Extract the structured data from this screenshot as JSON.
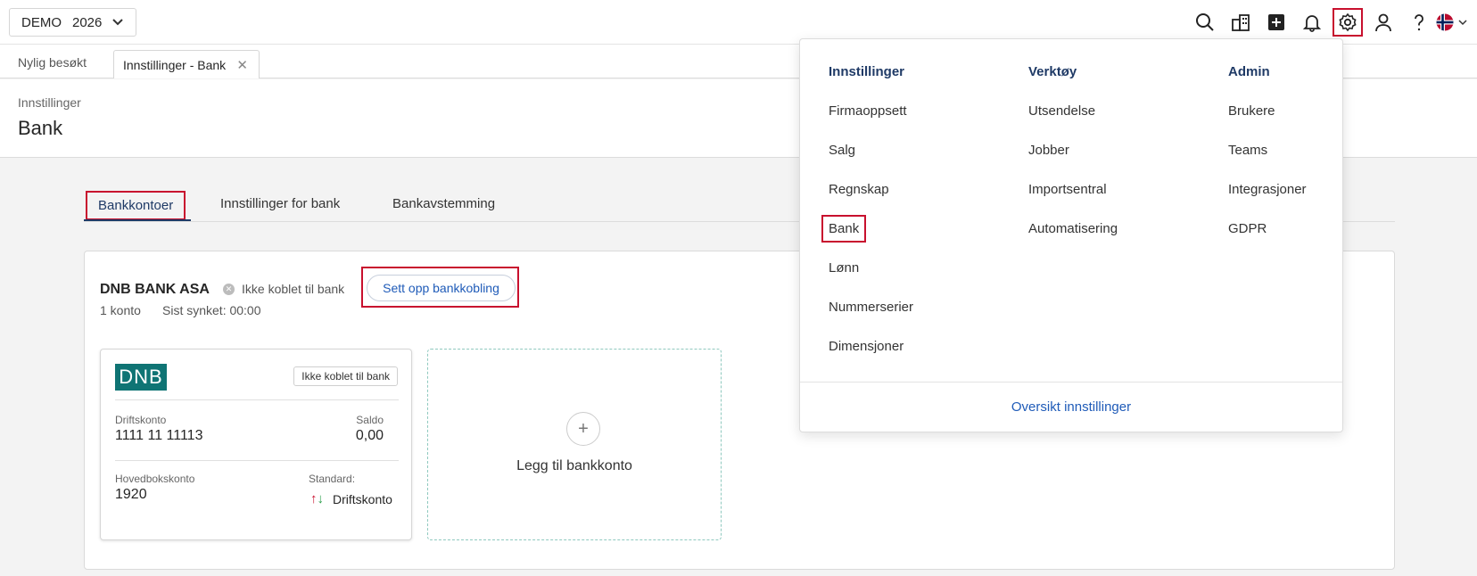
{
  "company": {
    "name": "DEMO",
    "year": "2026"
  },
  "topbar_icons": [
    "search-icon",
    "company-icon",
    "add-icon",
    "bell-icon",
    "settings-icon",
    "user-icon",
    "help-icon",
    "flag-icon"
  ],
  "tabs": {
    "recent": "Nylig besøkt",
    "open_tab": "Innstillinger - Bank"
  },
  "header": {
    "breadcrumb": "Innstillinger",
    "title": "Bank"
  },
  "subtabs": [
    "Bankkontoer",
    "Innstillinger for bank",
    "Bankavstemming"
  ],
  "bank": {
    "name": "DNB BANK ASA",
    "status": "Ikke koblet til bank",
    "setup_button": "Sett opp bankkobling",
    "accounts_count": "1 konto",
    "last_synced": "Sist synket: 00:00"
  },
  "account_card": {
    "logo": "DNB",
    "status_pill": "Ikke koblet til bank",
    "account_label": "Driftskonto",
    "account_number": "1111 11 11113",
    "balance_label": "Saldo",
    "balance": "0,00",
    "ledger_label": "Hovedbokskonto",
    "ledger_number": "1920",
    "default_label": "Standard:",
    "default_value": "Driftskonto"
  },
  "add_card": {
    "plus": "+",
    "label": "Legg til bankkonto"
  },
  "settings_menu": {
    "columns": [
      {
        "title": "Innstillinger",
        "items": [
          "Firmaoppsett",
          "Salg",
          "Regnskap",
          "Bank",
          "Lønn",
          "Nummerserier",
          "Dimensjoner"
        ]
      },
      {
        "title": "Verktøy",
        "items": [
          "Utsendelse",
          "Jobber",
          "Importsentral",
          "Automatisering"
        ]
      },
      {
        "title": "Admin",
        "items": [
          "Brukere",
          "Teams",
          "Integrasjoner",
          "GDPR"
        ]
      }
    ],
    "footer_link": "Oversikt innstillinger"
  },
  "colors": {
    "accent": "#1f3a66",
    "link": "#1f5bb8",
    "highlight": "#c8102e",
    "dnb": "#0f7474"
  }
}
